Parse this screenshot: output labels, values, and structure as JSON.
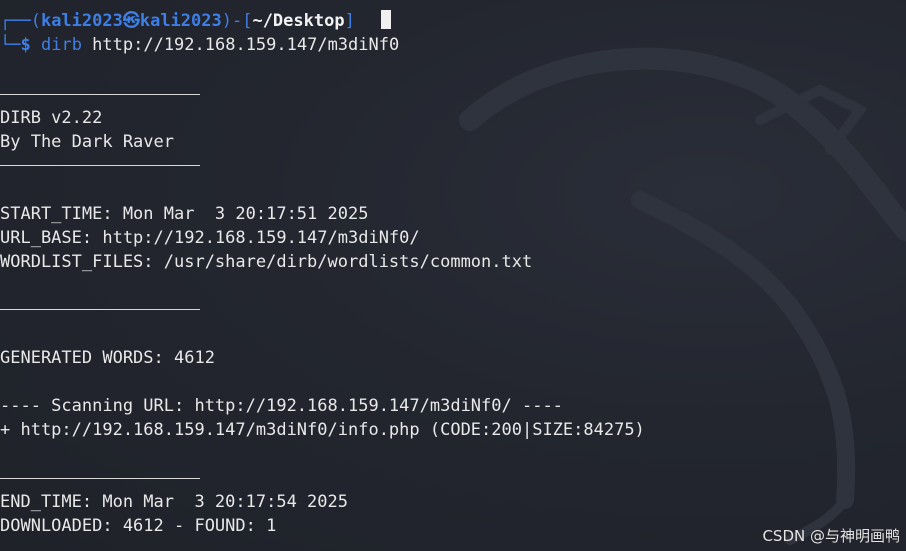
{
  "prompt": {
    "box_top": "┌──(",
    "user": "kali2023",
    "at_icon": "㉿",
    "host": "kali2023",
    "paren_close": ")-[",
    "cwd": "~/Desktop",
    "bracket_close": "]",
    "box_bottom": "└─",
    "dollar": "$",
    "command_name": "dirb",
    "command_args": " http://192.168.159.147/m3diNf0"
  },
  "output": {
    "banner_version": "DIRB v2.22",
    "banner_author": "By The Dark Raver",
    "start_time": "START_TIME: Mon Mar  3 20:17:51 2025",
    "url_base": "URL_BASE: http://192.168.159.147/m3diNf0/",
    "wordlist": "WORDLIST_FILES: /usr/share/dirb/wordlists/common.txt",
    "generated_words": "GENERATED WORDS: 4612",
    "scanning_url": "---- Scanning URL: http://192.168.159.147/m3diNf0/ ----",
    "found_entry": "+ http://192.168.159.147/m3diNf0/info.php (CODE:200|SIZE:84275)",
    "end_time": "END_TIME: Mon Mar  3 20:17:54 2025",
    "downloaded": "DOWNLOADED: 4612 - FOUND: 1"
  },
  "watermark": "CSDN @与神明画鸭",
  "colors": {
    "background": "#23262f",
    "prompt_blue": "#3d7fe6",
    "text": "#e8e8e8"
  }
}
